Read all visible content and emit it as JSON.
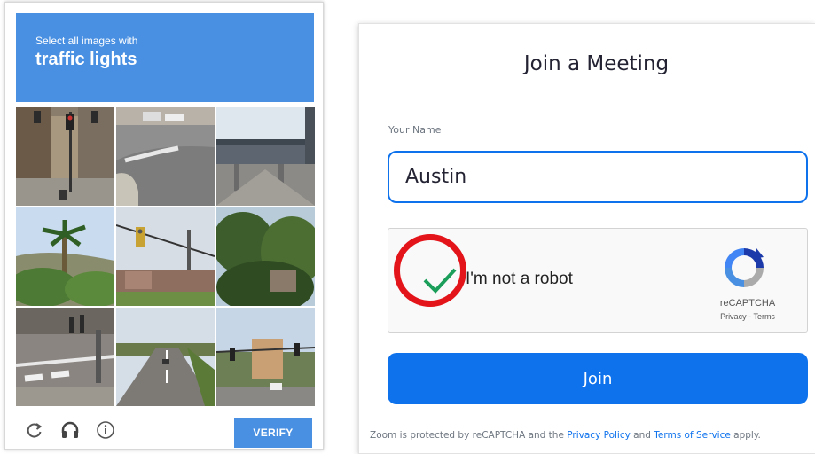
{
  "captcha": {
    "instruction": "Select all images with",
    "target": "traffic lights",
    "verify_label": "VERIFY",
    "icons": [
      "reload-icon",
      "headphones-icon",
      "info-icon"
    ],
    "accent_color": "#4a90e2",
    "tiles": [
      "street-corner-tile",
      "crosswalk-tile",
      "overpass-tile",
      "palm-tree-tile",
      "traffic-signal-tile",
      "trees-tile",
      "crosswalk-pedestrians-tile",
      "road-tile",
      "intersection-tile"
    ]
  },
  "zoom": {
    "title": "Join a Meeting",
    "name_label": "Your Name",
    "name_value": "Austin",
    "recaptcha_label": "I'm not a robot",
    "recaptcha_brand": "reCAPTCHA",
    "privacy_link": "Privacy",
    "links_sep": "-",
    "terms_link": "Terms",
    "join_label": "Join",
    "disclaimer_prefix": "Zoom is protected by reCAPTCHA and the",
    "disclaimer_privacy": "Privacy Policy",
    "disclaimer_and": "and",
    "disclaimer_terms": "Terms of Service",
    "disclaimer_suffix": "apply.",
    "accent_color": "#0e72ed",
    "check_color": "#1a9e5a",
    "highlight_color": "#e3141a"
  }
}
